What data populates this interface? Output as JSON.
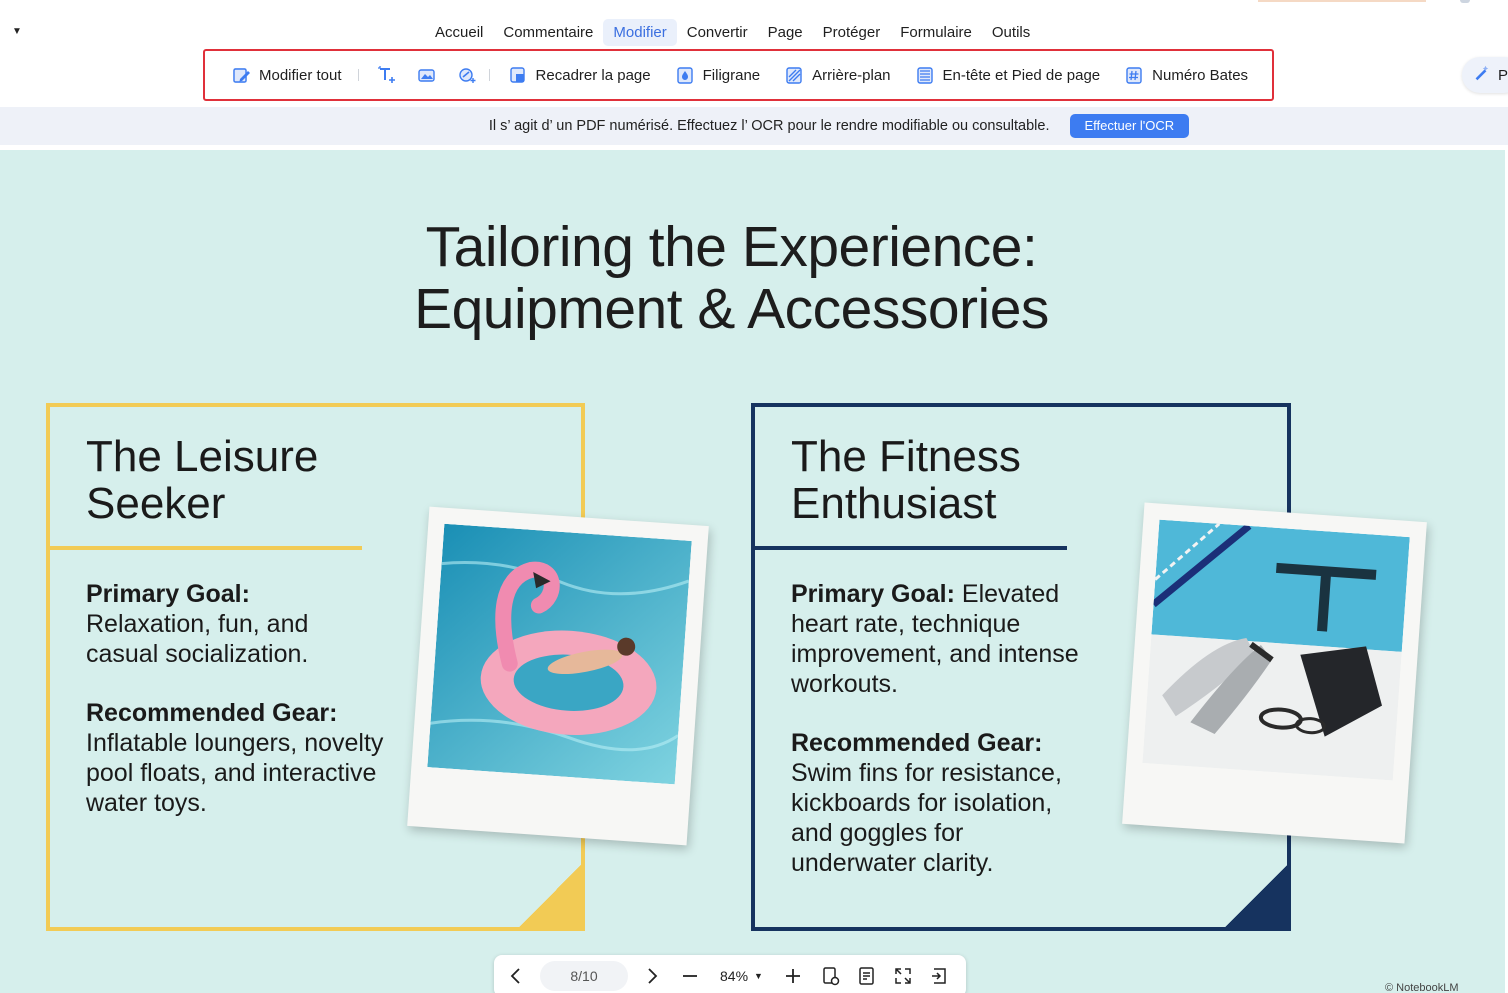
{
  "menu": {
    "items": [
      "Accueil",
      "Commentaire",
      "Modifier",
      "Convertir",
      "Page",
      "Protéger",
      "Formulaire",
      "Outils"
    ],
    "active": "Modifier"
  },
  "toolbar": {
    "edit_all": "Modifier tout",
    "crop_page": "Recadrer la page",
    "watermark": "Filigrane",
    "background": "Arrière-plan",
    "header_footer": "En-tête et Pied de page",
    "bates": "Numéro Bates",
    "right_partial": "P"
  },
  "ocr": {
    "message": "Il s’ agit d’ un PDF numérisé. Effectuez l’ OCR pour le rendre modifiable ou consultable.",
    "button": "Effectuer l'OCR"
  },
  "slide": {
    "title_line1": "Tailoring the Experience:",
    "title_line2": "Equipment & Accessories",
    "leisure": {
      "heading_line1": "The Leisure",
      "heading_line2": "Seeker",
      "goal_label": "Primary Goal:",
      "goal_text": "Relaxation, fun, and casual socialization.",
      "gear_label": "Recommended Gear:",
      "gear_text": "Inflatable loungers, novelty pool floats, and interactive water toys."
    },
    "fitness": {
      "heading_line1": "The Fitness",
      "heading_line2": "Enthusiast",
      "goal_label": "Primary Goal:",
      "goal_text": "Elevated heart rate, technique improvement, and intense workouts.",
      "gear_label": "Recommended Gear:",
      "gear_text": "Swim fins for resistance, kickboards for isolation, and goggles for underwater clarity."
    },
    "credit": "© NotebookLM"
  },
  "nav": {
    "page": "8/10",
    "zoom": "84%"
  },
  "colors": {
    "accent_blue": "#3d7cf1",
    "highlight_red": "#e0303a",
    "slide_bg": "#d6efec",
    "leisure_yellow": "#f2cb55",
    "fitness_navy": "#16335f"
  }
}
